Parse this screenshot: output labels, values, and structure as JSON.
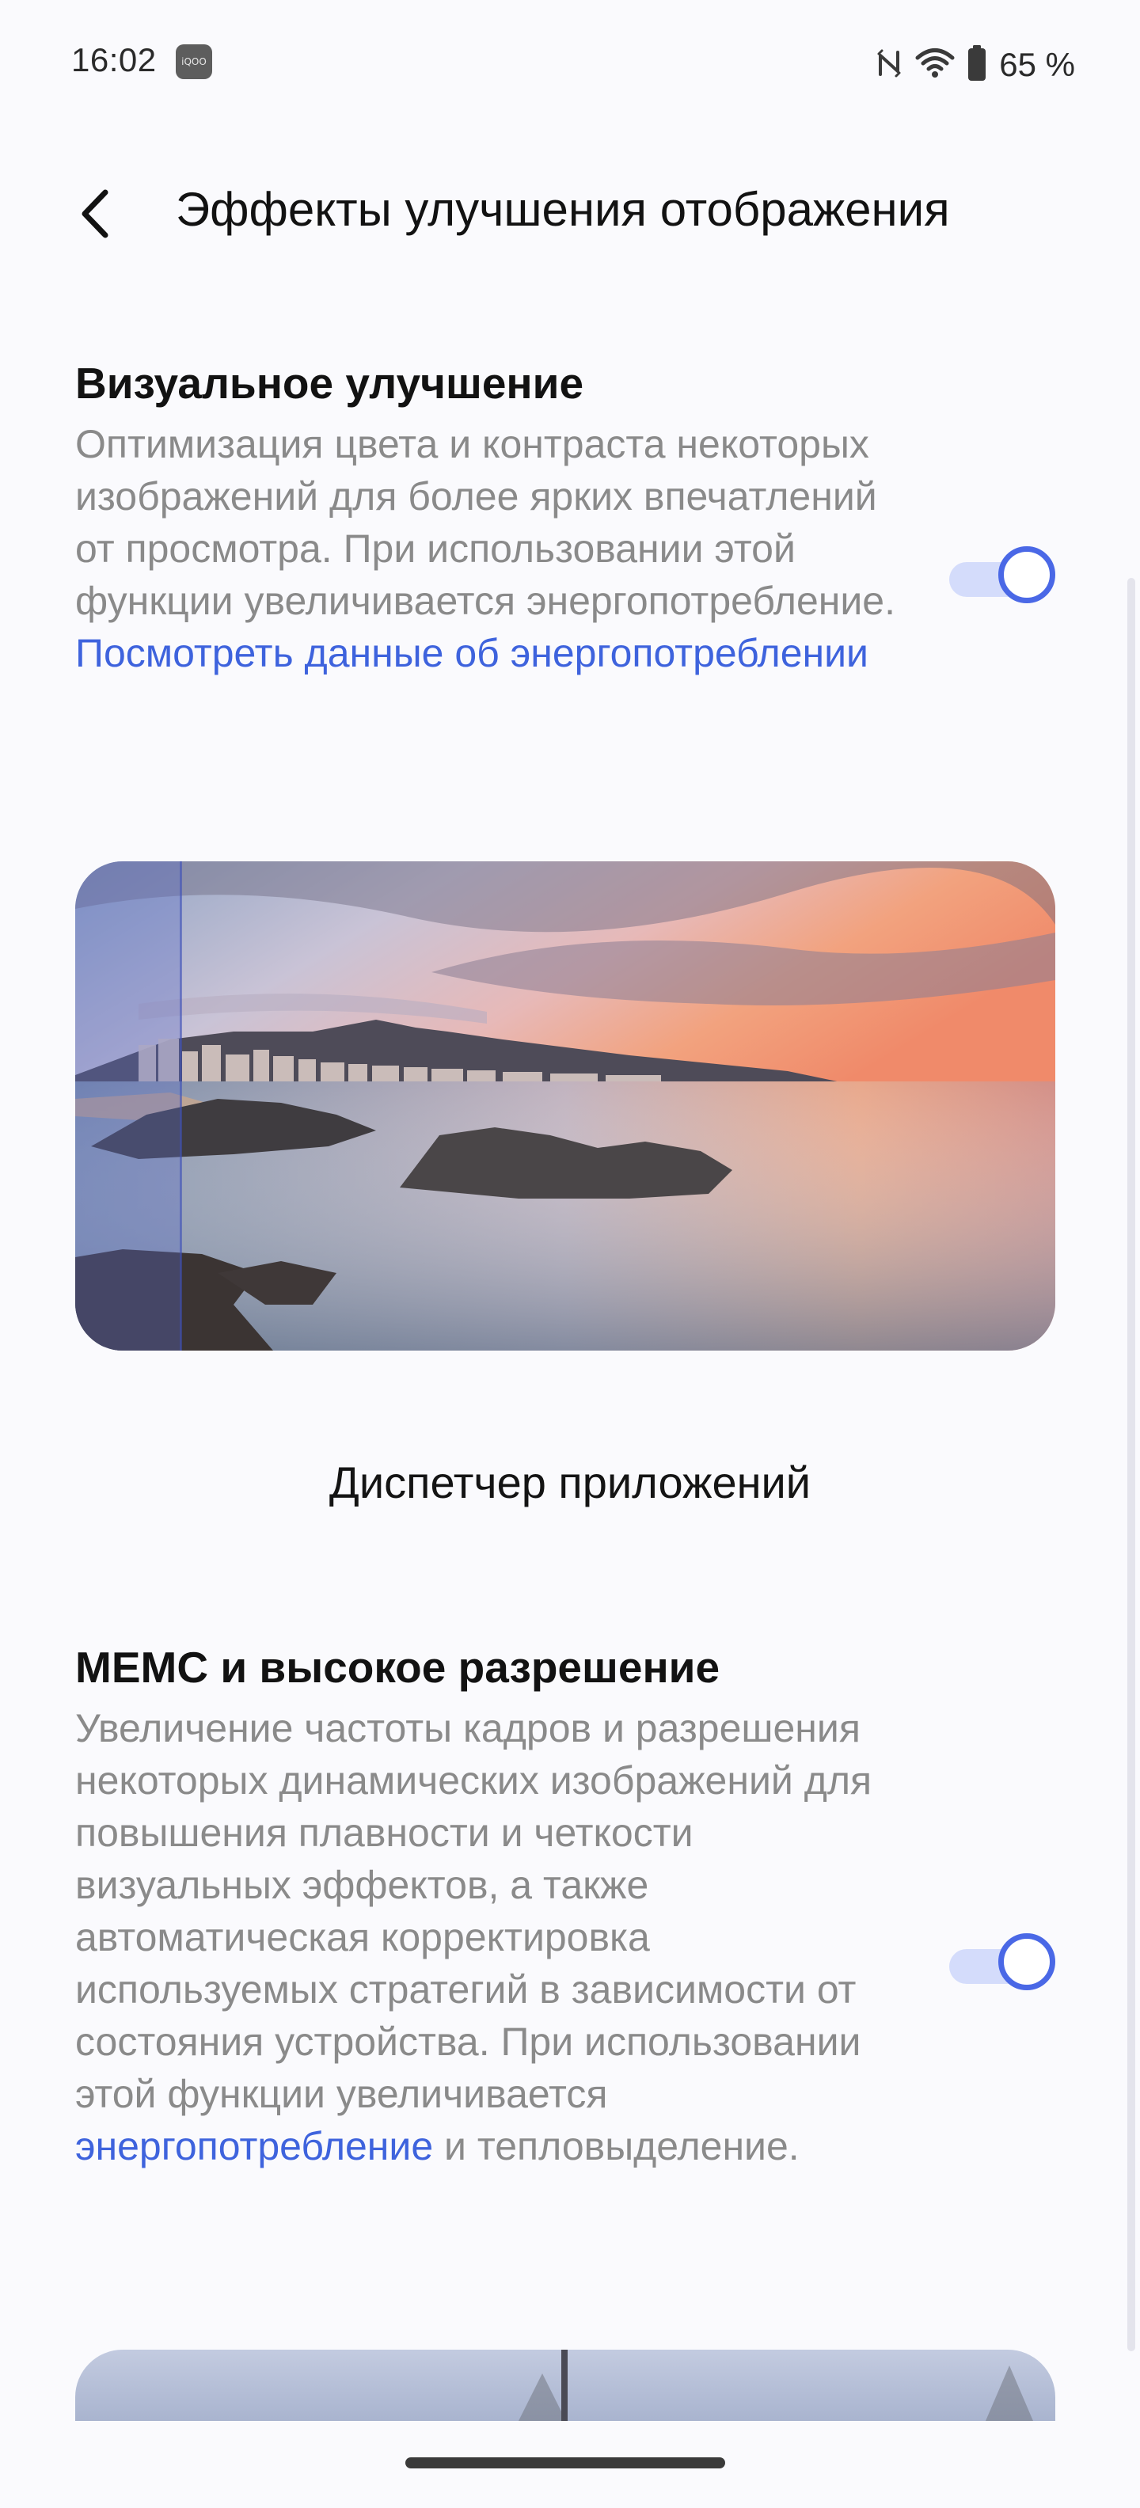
{
  "status_bar": {
    "time": "16:02",
    "brand_logo": "iQOO",
    "battery_text": "65 %",
    "icons": [
      "nfc-icon",
      "wifi-icon",
      "battery-icon"
    ]
  },
  "header": {
    "title": "Эффекты улучшения отображения",
    "back_icon": "chevron-left-icon"
  },
  "visual_enhancement": {
    "title": "Визуальное улучшение",
    "description": "Оптимизация цвета и контраста некоторых изображений для более ярких впечатлений от просмотра. При использовании этой функции увеличивается энергопотребление.",
    "link": "Посмотреть данные об энергопотреблении",
    "enabled": true
  },
  "preview_image": {
    "description_icon": "seaside-sunset-image"
  },
  "app_manager": {
    "label": "Диспетчер приложений"
  },
  "memc": {
    "title": "MEMC и высокое разрешение",
    "description_before": "Увеличение частоты кадров и разрешения некоторых динамических изображений для повышения плавности и четкости визуальных эффектов, а также автоматическая корректировка используемых стратегий в зависимости от состояния устройства. При использовании этой функции увеличивается ",
    "link": "энергопотребление",
    "description_after": " и тепловыделение.",
    "enabled": true
  },
  "colors": {
    "accent": "#4a68e6",
    "link": "#3e63dd",
    "toggle_track": "#d4dcfb",
    "background": "#fafafd"
  }
}
